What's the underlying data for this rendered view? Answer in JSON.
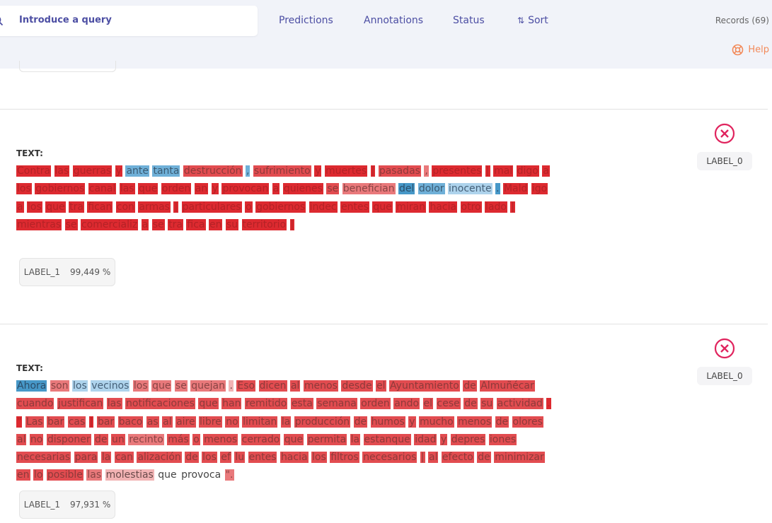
{
  "search": {
    "placeholder": "Introduce a query"
  },
  "filters": {
    "predictions": "Predictions",
    "annotations": "Annotations",
    "status": "Status",
    "sort": "Sort"
  },
  "records_label": "Records (69)",
  "help_label": "Help",
  "colors": {
    "accent": "#4c4ea3",
    "help": "#f28a5a",
    "discard": "#e0245e"
  },
  "records": [
    {
      "heading": "TEXT:",
      "tokens": [
        {
          "t": "Contra",
          "c": "r1"
        },
        {
          "t": "las",
          "c": "r1"
        },
        {
          "t": "guerras",
          "c": "r1"
        },
        {
          "t": "y",
          "c": "r1"
        },
        {
          "t": "ante",
          "c": "b2"
        },
        {
          "t": "tanta",
          "c": "b2"
        },
        {
          "t": "destrucción",
          "c": "r2"
        },
        {
          "t": ",",
          "c": "b2"
        },
        {
          "t": "sufrimiento",
          "c": "r2"
        },
        {
          "t": "y",
          "c": "r1"
        },
        {
          "t": "muertes",
          "c": "r1"
        },
        {
          "t": "|",
          "c": "r1"
        },
        {
          "t": "pasadas",
          "c": "r2"
        },
        {
          "t": ",",
          "c": "r3"
        },
        {
          "t": "presentes",
          "c": "r1"
        },
        {
          "t": "|",
          "c": "r1"
        },
        {
          "t": "mal",
          "c": "r1"
        },
        {
          "t": "digo",
          "c": "r1"
        },
        {
          "t": "a",
          "c": "r1"
        },
        {
          "t": "los",
          "c": "r1"
        },
        {
          "t": "gobiernos",
          "c": "r1"
        },
        {
          "t": "canal",
          "c": "r1"
        },
        {
          "t": "las",
          "c": "r1"
        },
        {
          "t": "que",
          "c": "r1"
        },
        {
          "t": "orden",
          "c": "r1"
        },
        {
          "t": "an",
          "c": "r1"
        },
        {
          "t": "y",
          "c": "r1"
        },
        {
          "t": "provocan",
          "c": "r1"
        },
        {
          "t": "a",
          "c": "r1"
        },
        {
          "t": "quienes",
          "c": "r1"
        },
        {
          "t": "se",
          "c": "r2"
        },
        {
          "t": "benefician",
          "c": "r3"
        },
        {
          "t": "del",
          "c": "b1"
        },
        {
          "t": "dolor",
          "c": "b2"
        },
        {
          "t": "inocente",
          "c": "b3"
        },
        {
          "t": ".",
          "c": "b1"
        },
        {
          "t": "Mald",
          "c": "r1"
        },
        {
          "t": "igo",
          "c": "r1"
        },
        {
          "t": "a",
          "c": "r1"
        },
        {
          "t": "los",
          "c": "r1"
        },
        {
          "t": "que",
          "c": "r1"
        },
        {
          "t": "tra",
          "c": "r1"
        },
        {
          "t": "fican",
          "c": "r1"
        },
        {
          "t": "con",
          "c": "r1"
        },
        {
          "t": "armas",
          "c": "r1"
        },
        {
          "t": "|",
          "c": "r1"
        },
        {
          "t": "particulares",
          "c": "r1"
        },
        {
          "t": "o",
          "c": "r1"
        },
        {
          "t": "gobiernos",
          "c": "r1"
        },
        {
          "t": "indec",
          "c": "r1"
        },
        {
          "t": "entes",
          "c": "r1"
        },
        {
          "t": "que",
          "c": "r1"
        },
        {
          "t": "miran",
          "c": "r1"
        },
        {
          "t": "hacia",
          "c": "r1"
        },
        {
          "t": "otro",
          "c": "r1"
        },
        {
          "t": "lado",
          "c": "r1"
        },
        {
          "t": "|",
          "c": "r1"
        },
        {
          "t": "mientras",
          "c": "r1"
        },
        {
          "t": "se",
          "c": "r1"
        },
        {
          "t": "comercializ",
          "c": "r1"
        },
        {
          "t": "a",
          "c": "r1"
        },
        {
          "t": "se",
          "c": "r1"
        },
        {
          "t": "tra",
          "c": "r1"
        },
        {
          "t": "fica",
          "c": "r1"
        },
        {
          "t": "en",
          "c": "r1"
        },
        {
          "t": "su",
          "c": "r1"
        },
        {
          "t": "territorio",
          "c": "r1"
        },
        {
          "t": "|",
          "c": "r1"
        }
      ],
      "prediction": {
        "label": "LABEL_1",
        "score": "99,449 %"
      },
      "annotation": "LABEL_0"
    },
    {
      "heading": "TEXT:",
      "tokens": [
        {
          "t": "Ahora",
          "c": "b1"
        },
        {
          "t": "son",
          "c": "r3"
        },
        {
          "t": "los",
          "c": "b3"
        },
        {
          "t": "vecinos",
          "c": "b3"
        },
        {
          "t": "los",
          "c": "r3"
        },
        {
          "t": "que",
          "c": "r3"
        },
        {
          "t": "se",
          "c": "r3"
        },
        {
          "t": "quejan",
          "c": "r3"
        },
        {
          "t": ".",
          "c": "r4"
        },
        {
          "t": "Eso",
          "c": "r2"
        },
        {
          "t": "dicen",
          "c": "r2"
        },
        {
          "t": "al",
          "c": "r2"
        },
        {
          "t": "menos",
          "c": "r2"
        },
        {
          "t": "desde",
          "c": "r2"
        },
        {
          "t": "el",
          "c": "r2"
        },
        {
          "t": "Ayuntamiento",
          "c": "r2"
        },
        {
          "t": "de",
          "c": "r2"
        },
        {
          "t": "Almuñécar",
          "c": "r2"
        },
        {
          "t": "cuando",
          "c": "r2"
        },
        {
          "t": "justifican",
          "c": "r2"
        },
        {
          "t": "las",
          "c": "r2"
        },
        {
          "t": "notificaciones",
          "c": "r2"
        },
        {
          "t": "que",
          "c": "r2"
        },
        {
          "t": "han",
          "c": "r2"
        },
        {
          "t": "remitido",
          "c": "r2"
        },
        {
          "t": "esta",
          "c": "r2"
        },
        {
          "t": "semana",
          "c": "r2"
        },
        {
          "t": "orden",
          "c": "r2"
        },
        {
          "t": "ando",
          "c": "r2"
        },
        {
          "t": "el",
          "c": "r2"
        },
        {
          "t": "cese",
          "c": "r2"
        },
        {
          "t": "de",
          "c": "r2"
        },
        {
          "t": "su",
          "c": "r2"
        },
        {
          "t": "actividad",
          "c": "r2"
        },
        {
          "t": ".",
          "c": "r1"
        },
        {
          "t": "\"",
          "c": "r1"
        },
        {
          "t": "Las",
          "c": "r2"
        },
        {
          "t": "bar",
          "c": "r2"
        },
        {
          "t": "cas",
          "c": "r2"
        },
        {
          "t": "|",
          "c": "r1"
        },
        {
          "t": "bar",
          "c": "r2"
        },
        {
          "t": "baco",
          "c": "r2"
        },
        {
          "t": "as",
          "c": "r2"
        },
        {
          "t": "al",
          "c": "r2"
        },
        {
          "t": "aire",
          "c": "r2"
        },
        {
          "t": "libre",
          "c": "r2"
        },
        {
          "t": "no",
          "c": "r2"
        },
        {
          "t": "limitan",
          "c": "r2"
        },
        {
          "t": "la",
          "c": "r2"
        },
        {
          "t": "producción",
          "c": "r2"
        },
        {
          "t": "de",
          "c": "r2"
        },
        {
          "t": "humos",
          "c": "r2"
        },
        {
          "t": "y",
          "c": "r2"
        },
        {
          "t": "mucho",
          "c": "r2"
        },
        {
          "t": "menos",
          "c": "r2"
        },
        {
          "t": "de",
          "c": "r2"
        },
        {
          "t": "olores",
          "c": "r2"
        },
        {
          "t": "al",
          "c": "r2"
        },
        {
          "t": "no",
          "c": "r2"
        },
        {
          "t": "disponer",
          "c": "r2"
        },
        {
          "t": "de",
          "c": "r2"
        },
        {
          "t": "un",
          "c": "r2"
        },
        {
          "t": "recinto",
          "c": "r3"
        },
        {
          "t": "más",
          "c": "r2"
        },
        {
          "t": "o",
          "c": "r2"
        },
        {
          "t": "menos",
          "c": "r2"
        },
        {
          "t": "cerrado",
          "c": "r2"
        },
        {
          "t": "que",
          "c": "r2"
        },
        {
          "t": "permita",
          "c": "r2"
        },
        {
          "t": "la",
          "c": "r2"
        },
        {
          "t": "estanque",
          "c": "r2"
        },
        {
          "t": "idad",
          "c": "r2"
        },
        {
          "t": "y",
          "c": "r2"
        },
        {
          "t": "depres",
          "c": "r2"
        },
        {
          "t": "iones",
          "c": "r2"
        },
        {
          "t": "necesarias",
          "c": "r2"
        },
        {
          "t": "para",
          "c": "r2"
        },
        {
          "t": "la",
          "c": "r2"
        },
        {
          "t": "can",
          "c": "r2"
        },
        {
          "t": "alización",
          "c": "r2"
        },
        {
          "t": "de",
          "c": "r2"
        },
        {
          "t": "los",
          "c": "r2"
        },
        {
          "t": "ef",
          "c": "r2"
        },
        {
          "t": "lu",
          "c": "r2"
        },
        {
          "t": "entes",
          "c": "r2"
        },
        {
          "t": "hacia",
          "c": "r2"
        },
        {
          "t": "los",
          "c": "r2"
        },
        {
          "t": "filtros",
          "c": "r2"
        },
        {
          "t": "necesarios",
          "c": "r2"
        },
        {
          "t": "|",
          "c": "r2"
        },
        {
          "t": "al",
          "c": "r2"
        },
        {
          "t": "efecto",
          "c": "r2"
        },
        {
          "t": "de",
          "c": "r2"
        },
        {
          "t": "minimizar",
          "c": "r2"
        },
        {
          "t": "en",
          "c": "r2"
        },
        {
          "t": "lo",
          "c": "r2"
        },
        {
          "t": "posible",
          "c": "r2"
        },
        {
          "t": "las",
          "c": "r3"
        },
        {
          "t": "molestias",
          "c": "r4"
        },
        {
          "t": "que",
          "c": ""
        },
        {
          "t": "provoca",
          "c": ""
        },
        {
          "t": "\".",
          "c": "r3"
        }
      ],
      "prediction": {
        "label": "LABEL_1",
        "score": "97,931 %"
      },
      "annotation": "LABEL_0"
    }
  ]
}
